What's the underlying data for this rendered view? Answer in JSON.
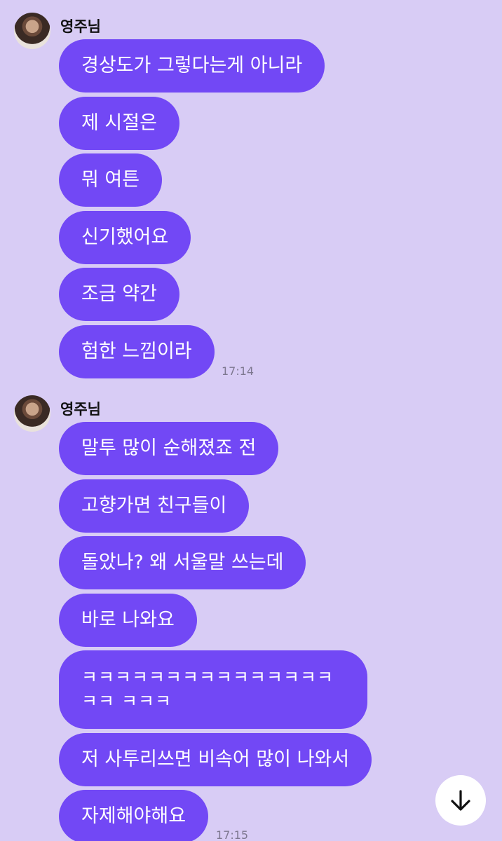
{
  "groups": [
    {
      "sender": "영주님",
      "messages": [
        "경상도가 그렇다는게 아니라",
        "제 시절은",
        "뭐 여튼",
        "신기했어요",
        "조금 약간",
        "험한 느낌이라"
      ],
      "time": "17:14"
    },
    {
      "sender": "영주님",
      "messages": [
        "말투 많이 순해졌죠 전",
        "고향가면 친구들이",
        "돌았나? 왜 서울말 쓰는데",
        "바로 나와요",
        "ㅋㅋㅋㅋㅋㅋㅋㅋㅋㅋㅋㅋㅋㅋㅋㅋㅋ ㅋㅋㅋ",
        "저 사투리쓰면 비속어 많이 나와서",
        "자제해야해요"
      ],
      "time": "17:15"
    }
  ],
  "scroll_button": {
    "icon": "arrow-down-icon"
  },
  "colors": {
    "background": "#d8ccf5",
    "bubble": "#7248f5",
    "bubble_text": "#ffffff"
  }
}
